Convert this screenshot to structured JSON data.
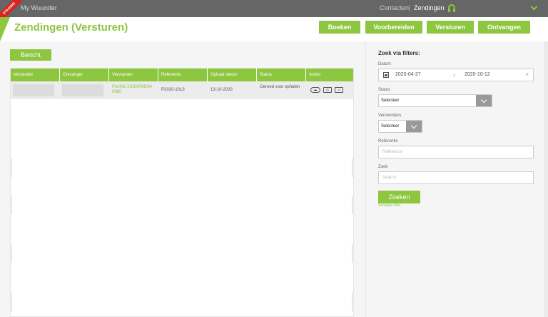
{
  "topbar": {
    "staging_ribbon": "STAGING",
    "app_name": "My Wuunder",
    "nav_contacten": "Contacten",
    "nav_zendingen": "Zendingen",
    "support_icon": "headset-icon",
    "menu_icon": "chevron-down-icon"
  },
  "header": {
    "title": "Zendingen (Versturen)",
    "buttons": [
      "Boeken",
      "Voorbereiden",
      "Versturen",
      "Ontvangen"
    ]
  },
  "toolbar": {
    "bericht_label": "Bericht"
  },
  "table": {
    "columns": [
      "Verzender",
      "Ontvanger",
      "Vervoerder",
      "Referentie",
      "Ophaal datum",
      "Status",
      "Acties"
    ],
    "rows": [
      {
        "verzender": "",
        "ontvanger": "",
        "vervoerder": "PostNL 3SDKRM084 0985",
        "referentie": "P2020-1013",
        "ophaal_datum": "13-10-2020",
        "status": "Gereed voor ophalen",
        "acties": [
          "chat-icon",
          "label-icon",
          "print-icon"
        ]
      }
    ]
  },
  "filters": {
    "title": "Zoek via filters:",
    "datum_label": "Datum",
    "date_from": "2020-04-27",
    "date_to": "2020-10-12",
    "status_label": "Status",
    "status_value": "Selecteer",
    "vervoerders_label": "Vervoerders",
    "vervoerders_value": "Selecteer",
    "referentie_label": "Referentie",
    "referentie_placeholder": "Reference",
    "zoek_label": "Zoek",
    "zoek_placeholder": "Search",
    "zoeken_button": "Zoeken",
    "clear_link": "Verwijder filter"
  },
  "colors": {
    "accent": "#8dc63f",
    "topbar": "#666666",
    "staging": "#d9251d"
  }
}
